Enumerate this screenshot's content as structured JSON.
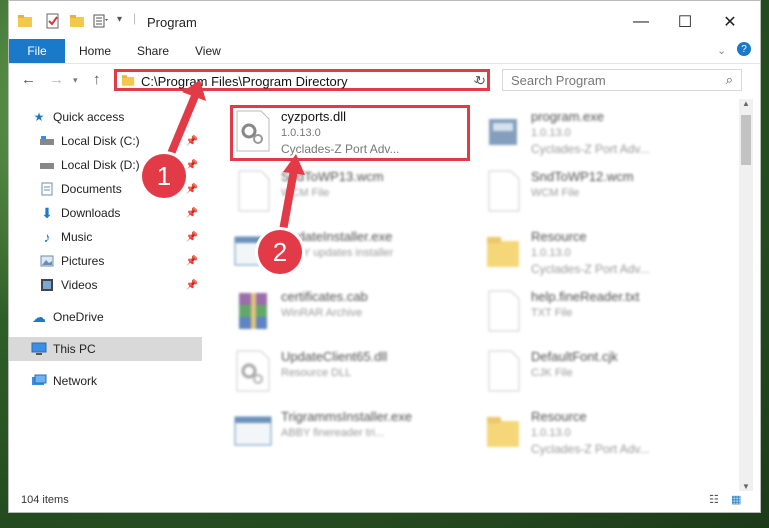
{
  "window": {
    "title": "Program",
    "caption": {
      "minimize": "—",
      "maximize": "☐",
      "close": "✕"
    }
  },
  "ribbon": {
    "tabs": [
      "File",
      "Home",
      "Share",
      "View"
    ]
  },
  "address": {
    "path": "C:\\Program Files\\Program Directory",
    "search_placeholder": "Search Program"
  },
  "sidebar": {
    "items": [
      {
        "label": "Quick access",
        "icon": "star-icon",
        "pinned": false
      },
      {
        "label": "Local Disk (C:)",
        "icon": "drive-icon",
        "pinned": true
      },
      {
        "label": "Local Disk (D:)",
        "icon": "drive-icon",
        "pinned": true
      },
      {
        "label": "Documents",
        "icon": "documents-icon",
        "pinned": true
      },
      {
        "label": "Downloads",
        "icon": "download-icon",
        "pinned": true
      },
      {
        "label": "Music",
        "icon": "music-icon",
        "pinned": true
      },
      {
        "label": "Pictures",
        "icon": "pictures-icon",
        "pinned": true
      },
      {
        "label": "Videos",
        "icon": "videos-icon",
        "pinned": true
      },
      {
        "label": "OneDrive",
        "icon": "cloud-icon",
        "pinned": false
      },
      {
        "label": "This PC",
        "icon": "pc-icon",
        "pinned": false
      },
      {
        "label": "Network",
        "icon": "network-icon",
        "pinned": false
      }
    ]
  },
  "files": {
    "left": [
      {
        "name": "cyzports.dll",
        "line2": "1.0.13.0",
        "line3": "Cyclades-Z Port Adv...",
        "icon": "dll-gear-icon"
      },
      {
        "name": "SndToWP13.wcm",
        "line2": "WCM File",
        "line3": "",
        "icon": "blank-file-icon"
      },
      {
        "name": "UpdateInstaller.exe",
        "line2": "ABBY updates installer",
        "line3": "",
        "icon": "exe-window-icon"
      },
      {
        "name": "certificates.cab",
        "line2": "WinRAR Archive",
        "line3": "",
        "icon": "winrar-icon"
      },
      {
        "name": "UpdateClient65.dll",
        "line2": "Resource DLL",
        "line3": "",
        "icon": "dll-gear-icon"
      },
      {
        "name": "TrigrammsInstaller.exe",
        "line2": "ABBY finereader tri...",
        "line3": "",
        "icon": "exe-window-icon"
      }
    ],
    "right": [
      {
        "name": "program.exe",
        "line2": "1.0.13.0",
        "line3": "Cyclades-Z Port Adv...",
        "icon": "program-exe-icon"
      },
      {
        "name": "SndToWP12.wcm",
        "line2": "WCM File",
        "line3": "",
        "icon": "blank-file-icon"
      },
      {
        "name": "Resource",
        "line2": "1.0.13.0",
        "line3": "Cyclades-Z Port Adv...",
        "icon": "folder-icon"
      },
      {
        "name": "help.fineReader.txt",
        "line2": "TXT File",
        "line3": "",
        "icon": "text-file-icon"
      },
      {
        "name": "DefaultFont.cjk",
        "line2": "CJK File",
        "line3": "",
        "icon": "blank-file-icon"
      },
      {
        "name": "Resource",
        "line2": "1.0.13.0",
        "line3": "Cyclades-Z Port Adv...",
        "icon": "folder-icon"
      }
    ]
  },
  "status": {
    "count": "104 items"
  },
  "callouts": {
    "one": "1",
    "two": "2"
  },
  "colors": {
    "accent": "#1979ca",
    "highlight": "#e23a46"
  }
}
